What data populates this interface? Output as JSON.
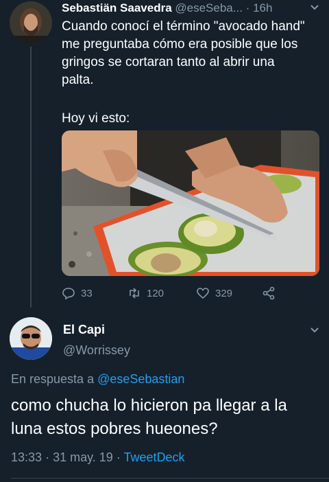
{
  "tweet": {
    "author_name": "Sebastiän Saavedra",
    "author_handle": "@eseSeba...",
    "separator": "·",
    "time": "16h",
    "text": "Cuando conocí el término \"avocado hand\"\nme preguntaba cómo era posible que los\ngringos se cortaran tanto al abrir una\npalta.",
    "text2": "Hoy vi esto:",
    "actions": {
      "replies": "33",
      "retweets": "120",
      "likes": "329"
    }
  },
  "reply": {
    "author_name": "El Capi",
    "author_handle": "@Worrissey",
    "in_reply_prefix": "En respuesta a ",
    "in_reply_handle": "@eseSebastian",
    "text": "como chucha lo hicieron pa llegar a la luna estos pobres hueones?",
    "time": "13:33",
    "date": "31 may. 19",
    "separator": "·",
    "source": "TweetDeck"
  },
  "colors": {
    "background": "#15202b",
    "muted": "#8899a6",
    "link": "#1da1f2",
    "divider": "#38444d"
  },
  "icons": [
    "reply-icon",
    "retweet-icon",
    "like-icon",
    "share-icon",
    "chevron-down-icon"
  ]
}
